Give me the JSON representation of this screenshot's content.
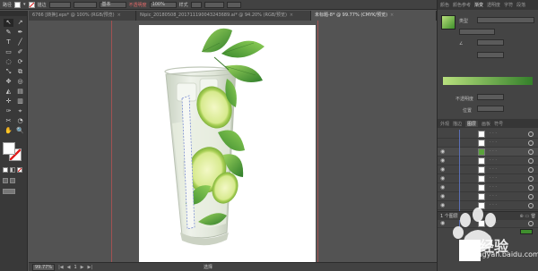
{
  "control_bar": {
    "label_path": "路径",
    "stroke_label": "描边",
    "stroke_weight": "",
    "stroke_profile": "基本",
    "opacity_label": "不透明度",
    "opacity_value": "100%",
    "style_label": "样式",
    "accent_red": "#e02020"
  },
  "tabs": [
    {
      "label": "6766 [转换].eps* @ 100% (RGB/预览)",
      "close": "×"
    },
    {
      "label": "Nipic_20180508_201711190043243689.ai* @ 94.20% (RGB/预览)",
      "close": "×"
    },
    {
      "label": "未标题-8* @ 99.77% (CMYK/预览)",
      "close": "×"
    }
  ],
  "tools": [
    "↖",
    "↗",
    "✎",
    "✒",
    "T",
    "╱",
    "▭",
    "✐",
    "◌",
    "⟳",
    "⤡",
    "⧉",
    "✥",
    "◎",
    "◭",
    "▤",
    "✛",
    "▥",
    "✑",
    "⌖",
    "✂",
    "◔",
    "✋",
    "🔍"
  ],
  "status_bar": {
    "zoom": "99.77%",
    "prev": "◀",
    "first": "|◀",
    "page": "1",
    "next": "▶",
    "last": "▶|",
    "selection_label": "选择"
  },
  "right_panel": {
    "tabs": [
      "颜色",
      "颜色参考",
      "渐变",
      "透明度",
      "字符",
      "段落"
    ],
    "active_tab": "渐变",
    "type_label": "类型",
    "angle_label": "角度",
    "opacity_label": "不透明度",
    "position_label": "位置",
    "gradient_start": "#b8e07e",
    "gradient_end": "#34802a"
  },
  "layers_panel": {
    "tabs": [
      "外观",
      "描边",
      "图层",
      "画板",
      "符号"
    ],
    "active_tab": "图层",
    "row_count": 11,
    "footer_label": "1 个图层"
  },
  "watermark": {
    "text": "经验",
    "url": "jingyan.baidu.com"
  }
}
